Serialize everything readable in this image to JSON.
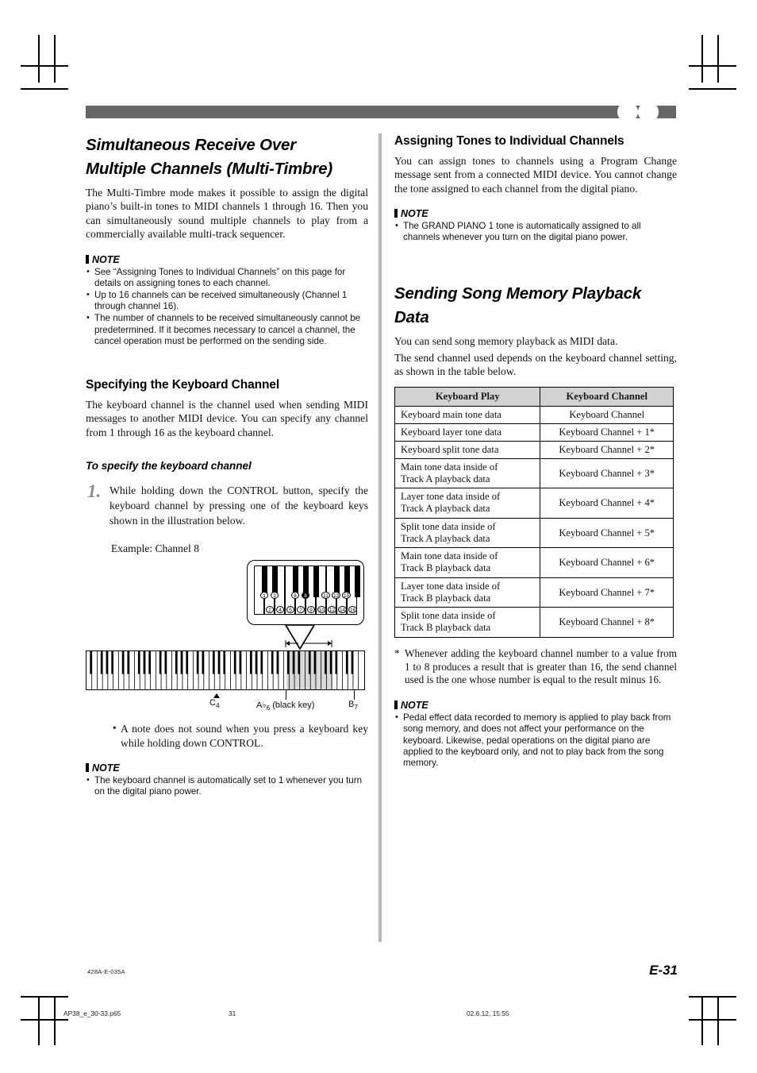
{
  "document": {
    "footer_code": "428A-E-035A",
    "page_label": "E-31",
    "print_file": "AP38_e_30-33.p65",
    "print_page": "31",
    "print_date": "02.6.12, 15:55",
    "accent_gray": "#666666",
    "table_header_gray": "#d2d2d2"
  },
  "left_column": {
    "section1": {
      "title_line1": "Simultaneous Receive Over",
      "title_line2": "Multiple Channels (Multi-Timbre)",
      "paragraph": "The Multi-Timbre mode makes it possible to assign the digital piano’s built-in tones to MIDI channels 1 through 16. Then you can simultaneously sound multiple channels to play from a commercially available multi-track sequencer.",
      "note_label": "NOTE",
      "notes": [
        "See “Assigning Tones to Individual Channels” on this page for details on assigning tones to each channel.",
        "Up to 16 channels can be received simultaneously (Channel 1 through channel 16).",
        "The number of channels to be received simultaneously cannot be predetermined. If it becomes necessary to cancel a channel, the cancel operation must be performed on the sending side."
      ]
    },
    "section2": {
      "title": "Specifying the Keyboard Channel",
      "paragraph": "The keyboard channel is the channel used when sending MIDI messages to another MIDI device. You can specify any channel from 1 through 16 as the keyboard channel.",
      "procedure_title": "To specify the keyboard channel",
      "step_number": "1.",
      "step_text": "While holding down the CONTROL button, specify the keyboard channel by pressing one of the keyboard keys shown in the illustration below.",
      "example_label": "Example: Channel 8",
      "bullet_after_figure": "A note does not sound when you press a keyboard key while holding down CONTROL.",
      "note_label": "NOTE",
      "notes": [
        "The keyboard channel is automatically set to 1 whenever you turn on the digital piano power."
      ]
    },
    "figure": {
      "callout_black_key_numbers": [
        "1",
        "3",
        "6",
        "8",
        "11",
        "13",
        "15"
      ],
      "callout_white_key_numbers": [
        "2",
        "4",
        "5",
        "7",
        "9",
        "10",
        "12",
        "14",
        "16"
      ],
      "highlighted_number": "8",
      "label_left": "C4",
      "label_left_note": "C",
      "label_left_octave": "4",
      "label_mid": "A♭6 (black key)",
      "label_mid_note": "A♭",
      "label_mid_octave": "6",
      "label_mid_suffix": " (black key)",
      "label_right": "B7",
      "label_right_note": "B",
      "label_right_octave": "7"
    }
  },
  "right_column": {
    "section3": {
      "title": "Assigning Tones to Individual Channels",
      "paragraph": "You can assign tones to channels using a Program Change message sent from a connected MIDI device. You cannot change the tone assigned to each channel from the digital piano.",
      "note_label": "NOTE",
      "notes": [
        "The GRAND PIANO 1 tone is automatically assigned to all channels whenever you turn on the digital piano power."
      ]
    },
    "section4": {
      "title_line1": "Sending Song Memory Playback",
      "title_line2": "Data",
      "paragraph1": "You can send song memory playback as MIDI data.",
      "paragraph2": "The send channel used depends on the keyboard channel setting, as shown in the table below.",
      "footnote": "Whenever adding the keyboard channel number to a value from 1 to 8 produces a result that is greater than 16, the send channel used is the one whose number is equal to the result minus 16.",
      "footnote_marker": "*",
      "note_label": "NOTE",
      "notes": [
        "Pedal effect data recorded to memory is applied to play back from song memory, and does not affect your performance on the keyboard. Likewise, pedal operations on the digital piano are applied to the keyboard only, and not to play back from the song memory."
      ]
    },
    "table": {
      "headers": [
        "Keyboard Play",
        "Keyboard Channel"
      ],
      "rows": [
        {
          "play": "Keyboard main tone data",
          "channel": "Keyboard Channel",
          "multiline": false
        },
        {
          "play": "Keyboard layer tone data",
          "channel": "Keyboard Channel + 1*",
          "multiline": false
        },
        {
          "play": "Keyboard split tone data",
          "channel": "Keyboard Channel + 2*",
          "multiline": false
        },
        {
          "play_l1": "Main tone data inside of",
          "play_l2": "Track A playback data",
          "play": "Main tone data inside of Track A playback data",
          "channel": "Keyboard Channel + 3*",
          "multiline": true
        },
        {
          "play_l1": "Layer tone data inside of",
          "play_l2": "Track A playback data",
          "play": "Layer tone data inside of Track A playback data",
          "channel": "Keyboard Channel + 4*",
          "multiline": true
        },
        {
          "play_l1": "Split tone data inside of",
          "play_l2": "Track A playback data",
          "play": "Split tone data inside of Track A playback data",
          "channel": "Keyboard Channel + 5*",
          "multiline": true
        },
        {
          "play_l1": "Main tone data inside of",
          "play_l2": "Track B playback data",
          "play": "Main tone data inside of Track B playback data",
          "channel": "Keyboard Channel + 6*",
          "multiline": true
        },
        {
          "play_l1": "Layer tone data inside of",
          "play_l2": "Track B playback data",
          "play": "Layer tone data inside of Track B playback data",
          "channel": "Keyboard Channel + 7*",
          "multiline": true
        },
        {
          "play_l1": "Split tone data inside of",
          "play_l2": "Track B playback data",
          "play": "Split tone data inside of Track B playback data",
          "channel": "Keyboard Channel + 8*",
          "multiline": true
        }
      ]
    }
  }
}
